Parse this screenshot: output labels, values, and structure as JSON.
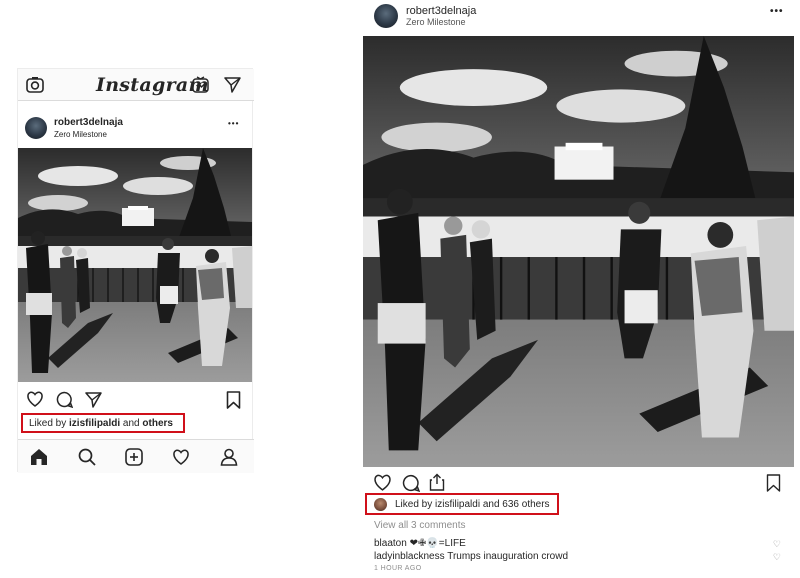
{
  "mobile": {
    "app_title": "Instagram",
    "username": "robert3delnaja",
    "location": "Zero Milestone",
    "more_label": "•••",
    "liked_prefix": "Liked by ",
    "liked_user": "izisfilipaldi",
    "liked_mid": " and ",
    "liked_suffix": "others",
    "nav_icons": [
      "home-icon",
      "search-icon",
      "add-post-icon",
      "heart-icon",
      "profile-icon"
    ]
  },
  "desktop": {
    "username": "robert3delnaja",
    "location": "Zero Milestone",
    "more_label": "•••",
    "liked_prefix": "Liked by ",
    "liked_user": "izisfilipaldi",
    "liked_mid": " and ",
    "liked_count": "636 others",
    "view_all": "View all 3 comments",
    "comments": [
      {
        "user": "blaaton",
        "text": " ❤✙💀=LIFE"
      },
      {
        "user": "ladyinblackness",
        "text": " Trumps inauguration crowd"
      }
    ],
    "time_ago": "1 HOUR AGO"
  },
  "colors": {
    "highlight": "#d0101a",
    "text": "#262626",
    "muted": "#8e8e8e",
    "border": "#dbdbdb"
  }
}
